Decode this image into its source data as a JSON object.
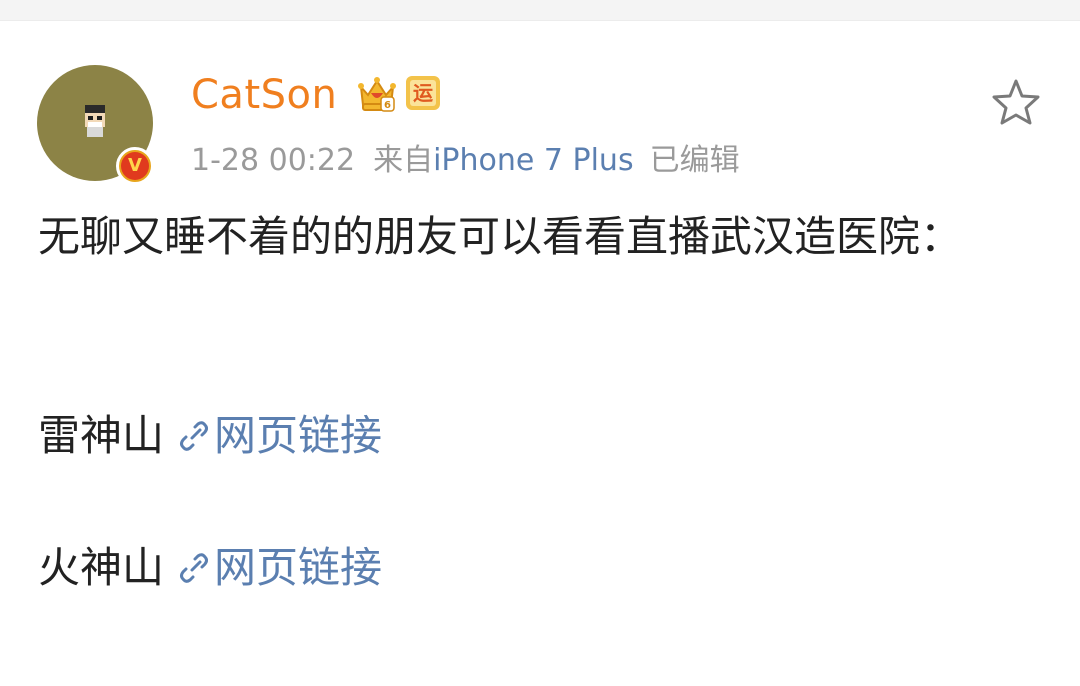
{
  "post": {
    "username": "CatSon",
    "crown_badge_icon": "crown-vip-icon",
    "yun_badge_label": "运",
    "verified_label": "V",
    "time": "1-28 00:22",
    "source_prefix": "来自",
    "source_device": "iPhone 7 Plus",
    "edited": "已编辑",
    "text": "无聊又睡不着的的朋友可以看看直播武汉造医院：",
    "links": [
      {
        "name": "雷神山",
        "link_label": "网页链接",
        "icon": "link-icon"
      },
      {
        "name": "火神山",
        "link_label": "网页链接",
        "icon": "link-icon"
      }
    ]
  },
  "colors": {
    "username": "#f07f1f",
    "link": "#5b7fb0",
    "meta": "#9a9a9a",
    "text": "#222222",
    "avatar_bg": "#8c8346"
  }
}
